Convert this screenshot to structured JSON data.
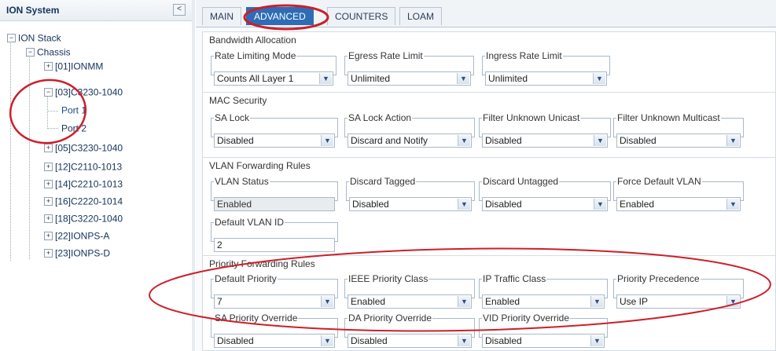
{
  "tree": {
    "title": "ION System",
    "collapse_glyph": "<",
    "items": [
      {
        "label": "ION Stack",
        "toggle": "−"
      },
      {
        "label": "Chassis",
        "toggle": "−"
      },
      {
        "label": "[01]IONMM",
        "toggle": "+"
      },
      {
        "label": "[03]C3230-1040",
        "toggle": "−"
      },
      {
        "label": "Port 1",
        "toggle": ""
      },
      {
        "label": "Port 2",
        "toggle": ""
      },
      {
        "label": "[05]C3230-1040",
        "toggle": "+"
      },
      {
        "label": "[12]C2110-1013",
        "toggle": "+"
      },
      {
        "label": "[14]C2210-1013",
        "toggle": "+"
      },
      {
        "label": "[16]C2220-1014",
        "toggle": "+"
      },
      {
        "label": "[18]C3220-1040",
        "toggle": "+"
      },
      {
        "label": "[22]IONPS-A",
        "toggle": "+"
      },
      {
        "label": "[23]IONPS-D",
        "toggle": "+"
      }
    ]
  },
  "tabs": [
    "MAIN",
    "ADVANCED",
    "COUNTERS",
    "LOAM"
  ],
  "active_tab": "ADVANCED",
  "dropdown_arrow": "▼",
  "sections": {
    "bandwidth": {
      "title": "Bandwidth Allocation",
      "fields": [
        {
          "label": "Rate Limiting Mode",
          "value": "Counts All Layer 1"
        },
        {
          "label": "Egress Rate Limit",
          "value": "Unlimited"
        },
        {
          "label": "Ingress Rate Limit",
          "value": "Unlimited"
        }
      ]
    },
    "mac": {
      "title": "MAC Security",
      "fields": [
        {
          "label": "SA Lock",
          "value": "Disabled"
        },
        {
          "label": "SA Lock Action",
          "value": "Discard and Notify"
        },
        {
          "label": "Filter Unknown Unicast",
          "value": "Disabled"
        },
        {
          "label": "Filter Unknown Multicast",
          "value": "Disabled"
        }
      ]
    },
    "vlan": {
      "title": "VLAN Forwarding Rules",
      "fields": [
        {
          "label": "VLAN Status",
          "value": "Enabled"
        },
        {
          "label": "Discard Tagged",
          "value": "Disabled"
        },
        {
          "label": "Discard Untagged",
          "value": "Disabled"
        },
        {
          "label": "Force Default VLAN",
          "value": "Enabled"
        },
        {
          "label": "Default VLAN ID",
          "value": "2"
        }
      ]
    },
    "priority": {
      "title": "Priority Forwarding Rules",
      "fields": [
        {
          "label": "Default Priority",
          "value": "7"
        },
        {
          "label": "IEEE Priority Class",
          "value": "Enabled"
        },
        {
          "label": "IP Traffic Class",
          "value": "Enabled"
        },
        {
          "label": "Priority Precedence",
          "value": "Use IP"
        },
        {
          "label": "SA Priority Override",
          "value": "Disabled"
        },
        {
          "label": "DA Priority Override",
          "value": "Disabled"
        },
        {
          "label": "VID Priority Override",
          "value": "Disabled"
        }
      ]
    }
  },
  "colors": {
    "annotation": "#cc1f2a",
    "active_tab": "#2e6db5",
    "tree_text": "#15325a"
  }
}
